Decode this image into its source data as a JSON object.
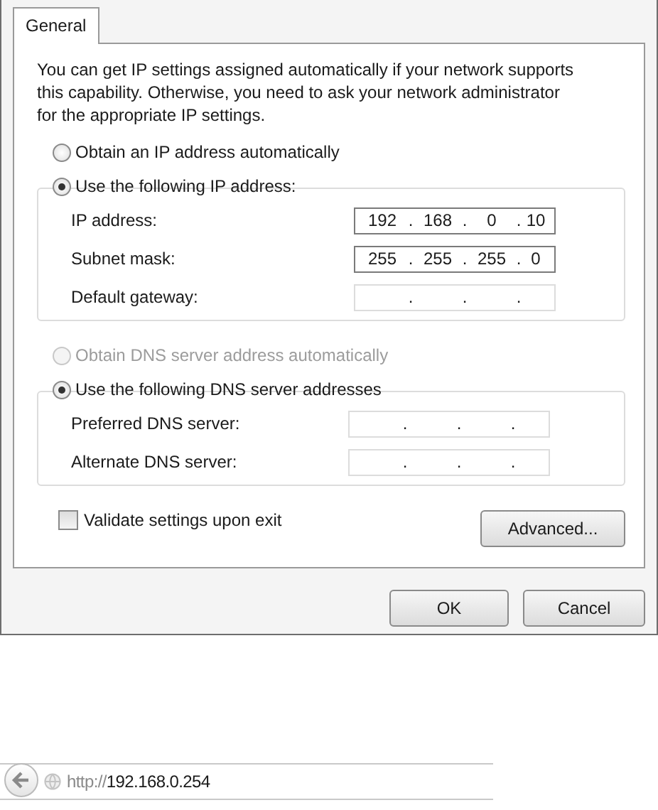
{
  "tabs": [
    {
      "label": "General",
      "selected": true
    }
  ],
  "description": "You can get IP settings assigned automatically if your network supports this capability. Otherwise, you need to ask your network administrator for the appropriate IP settings.",
  "ip_section": {
    "options": [
      {
        "label": "Obtain an IP address automatically",
        "selected": false,
        "disabled": false
      },
      {
        "label": "Use the following IP address:",
        "selected": true,
        "disabled": false
      }
    ],
    "fields": [
      {
        "label": "IP address:",
        "octets": [
          "192",
          "168",
          "0",
          "10"
        ],
        "dots": [
          ".",
          ".",
          "."
        ],
        "disabled": false
      },
      {
        "label": "Subnet mask:",
        "octets": [
          "255",
          "255",
          "255",
          "0"
        ],
        "dots": [
          ".",
          ".",
          "."
        ],
        "disabled": false
      },
      {
        "label": "Default gateway:",
        "dots": [
          ".",
          ".",
          "."
        ],
        "disabled": false
      }
    ]
  },
  "dns_section": {
    "options": [
      {
        "label": "Obtain DNS server address automatically",
        "selected": false,
        "disabled": true
      },
      {
        "label": "Use the following DNS server addresses",
        "selected": true,
        "disabled": false
      }
    ],
    "fields": [
      {
        "label": "Preferred DNS server:",
        "dots": [
          ".",
          ".",
          "."
        ],
        "disabled": false
      },
      {
        "label": "Alternate DNS server:",
        "dots": [
          ".",
          ".",
          "."
        ],
        "disabled": false
      }
    ]
  },
  "validate": {
    "label": "Validate settings upon exit",
    "checked": false
  },
  "advanced_button": "Advanced...",
  "buttons": [
    "OK",
    "Cancel"
  ],
  "browser_bar": {
    "scheme": "http://",
    "host": "192.168.0.254"
  }
}
